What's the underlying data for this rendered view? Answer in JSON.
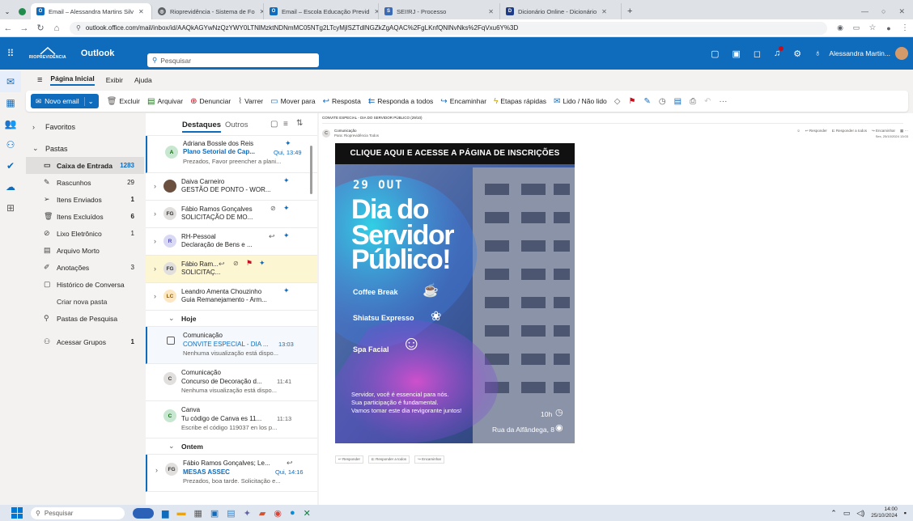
{
  "browser": {
    "tabs": [
      {
        "label": "Email – Alessandra Martins Silv",
        "color": "#0f6cbd",
        "letter": "O"
      },
      {
        "label": "Rioprevidência - Sistema de Fo",
        "color": "#5f6368",
        "letter": "R"
      },
      {
        "label": "Email – Escola Educação Previd",
        "color": "#0f6cbd",
        "letter": "O"
      },
      {
        "label": "SEI!RJ - Processo",
        "color": "#3b6bb5",
        "letter": "S"
      },
      {
        "label": "Dicionário Online - Dicionário",
        "color": "#1f3c88",
        "letter": "D"
      }
    ],
    "new_tab": "+",
    "url": "outlook.office.com/mail/inbox/id/AAQkAGYwNzQzYWY0LTNlMzktNDNmMC05NTg2LTcyMjlSZTdlNGZkZgAQAC%2FgLKnfQNlNvNks%2FqVxu6Y%3D"
  },
  "header": {
    "brand": "RIOPREVIDÊNCIA",
    "app": "Outlook",
    "search_placeholder": "Pesquisar",
    "user": "Alessandra Martin..."
  },
  "nav_tabs": [
    "Página Inicial",
    "Exibir",
    "Ajuda"
  ],
  "ribbon": {
    "new_mail": "Novo email",
    "items": [
      "Excluir",
      "Arquivar",
      "Denunciar",
      "Varrer",
      "Mover para",
      "Resposta",
      "Responda a todos",
      "Encaminhar",
      "Etapas rápidas",
      "Lido / Não lido"
    ]
  },
  "folders": {
    "favorites": "Favoritos",
    "pastas": "Pastas",
    "items": [
      {
        "label": "Caixa de Entrada",
        "count": "1283",
        "icon": "inbox-icon",
        "glyph": "▭",
        "bold": true
      },
      {
        "label": "Rascunhos",
        "count": "29",
        "icon": "draft-icon",
        "glyph": "✎"
      },
      {
        "label": "Itens Enviados",
        "count": "1",
        "icon": "sent-icon",
        "glyph": "➢"
      },
      {
        "label": "Itens Excluídos",
        "count": "6",
        "icon": "trash-icon",
        "glyph": "🗑"
      },
      {
        "label": "Lixo Eletrônico",
        "count": "1",
        "icon": "junk-icon",
        "glyph": "⊘"
      },
      {
        "label": "Arquivo Morto",
        "count": "",
        "icon": "archive-icon",
        "glyph": "▤"
      },
      {
        "label": "Anotações",
        "count": "3",
        "icon": "notes-icon",
        "glyph": "✐"
      },
      {
        "label": "Histórico de Conversa",
        "count": "",
        "icon": "folder-icon",
        "glyph": "▢"
      }
    ],
    "create_folder": "Criar nova pasta",
    "search_folders": "Pastas de Pesquisa",
    "groups": "Acessar Grupos",
    "groups_count": "1"
  },
  "list": {
    "tab_focused": "Destaques",
    "tab_other": "Outros",
    "pinned": [
      {
        "initials": "A",
        "sender": "Adriana Bossle dos Reis",
        "subject": "Plano Setorial de Cap...",
        "time": "Qui, 13:49",
        "preview": "Prezados, Favor preencher a plani...",
        "av_bg": "#c7e7d0",
        "av_fg": "#0b6a0b"
      },
      {
        "initials": "",
        "sender": "Daiva Carneiro",
        "subject": "GESTÃO DE PONTO - WOR...",
        "time": "",
        "preview": "",
        "av_bg": "#6b4f3f",
        "av_fg": "#fff"
      },
      {
        "initials": "FG",
        "sender": "Fábio Ramos Gonçalves",
        "subject": "SOLICITAÇÃO DE MO...",
        "time": "",
        "preview": "",
        "av_bg": "#e1dfdd",
        "av_fg": "#323130"
      },
      {
        "initials": "R",
        "sender": "RH-Pessoal",
        "subject": "Declaração de Bens e ...",
        "time": "",
        "preview": "",
        "av_bg": "#dad9f5",
        "av_fg": "#4f4bb8"
      },
      {
        "initials": "FG",
        "sender": "Fábio Ram...",
        "subject": "SOLICITAÇ...",
        "time": "",
        "preview": "",
        "av_bg": "#e1dfdd",
        "av_fg": "#323130"
      },
      {
        "initials": "LC",
        "sender": "Leandro Amenta Chouzinho",
        "subject": "Guia Remanejamento - Arm...",
        "time": "",
        "preview": "",
        "av_bg": "#fde7c2",
        "av_fg": "#8a5a00"
      }
    ],
    "group_today": "Hoje",
    "today": [
      {
        "initials": "",
        "sender": "Comunicação",
        "subject": "CONVITE ESPECIAL - DIA ...",
        "time": "13:03",
        "preview": "Nenhuma visualização está dispo..."
      },
      {
        "initials": "C",
        "sender": "Comunicação",
        "subject": "Concurso de Decoração d...",
        "time": "11:41",
        "preview": "Nenhuma visualização está dispo...",
        "av_bg": "#e1dfdd",
        "av_fg": "#323130"
      },
      {
        "initials": "C",
        "sender": "Canva",
        "subject": "Tu código de Canva es 11...",
        "time": "11:13",
        "preview": "Escribe el código 119037 en los p...",
        "av_bg": "#c7e7d0",
        "av_fg": "#0b6a0b"
      }
    ],
    "group_yesterday": "Ontem",
    "yesterday": [
      {
        "initials": "FG",
        "sender": "Fábio Ramos Gonçalves; Le...",
        "subject": "MESAS ASSEC",
        "time": "Qui, 14:16",
        "preview": "Prezados, boa tarde. Solicitação e...",
        "av_bg": "#e1dfdd",
        "av_fg": "#323130"
      }
    ]
  },
  "reading": {
    "subject": "CONVITE ESPECIAL - DIA DO SERVIDOR PÚBLICO (29/10)",
    "from": "Comunicação",
    "to": "Para: Rioprevidência Todos",
    "actions": [
      "Responder",
      "Responder a todos",
      "Encaminhar"
    ],
    "date": "Sex, 25/10/2024 13:03"
  },
  "poster": {
    "banner": "CLIQUE AQUI E ACESSE A PÁGINA DE INSCRIÇÕES",
    "date": "29 OUT",
    "title_1": "Dia do",
    "title_2": "Servidor",
    "title_3": "Público!",
    "item_1": "Coffee Break",
    "item_2": "Shiatsu Expresso",
    "item_3": "Spa Facial",
    "message_1": "Servidor, você é essencial para nós.",
    "message_2": "Sua participação é fundamental.",
    "message_3": "Vamos tomar este dia revigorante juntos!",
    "time": "10h",
    "address": "Rua da Alfândega, 8"
  },
  "taskbar": {
    "search": "Pesquisar",
    "clock_time": "14:00",
    "clock_date": "25/10/2024"
  },
  "colors": {
    "outlook_blue": "#0f6cbd",
    "flag_red": "#c50f1f",
    "selected_bg": "#fdf6d3"
  }
}
